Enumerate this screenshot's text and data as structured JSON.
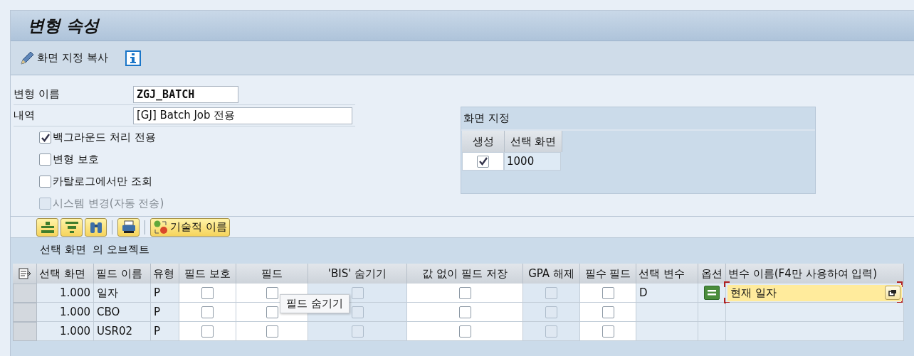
{
  "title": "변형 속성",
  "toolbar": [
    {
      "kind": "pencil",
      "label": "화면 지정 복사"
    },
    {
      "kind": "info"
    }
  ],
  "form": {
    "name_label": "변형 이름",
    "name_value": "ZGJ_BATCH",
    "desc_label": "내역",
    "desc_value": "[GJ] Batch Job 전용",
    "options": [
      {
        "label": "백그라운드 처리 전용",
        "checked": true,
        "disabled": false
      },
      {
        "label": "변형 보호",
        "checked": false,
        "disabled": false
      },
      {
        "label": "카탈로그에서만 조회",
        "checked": false,
        "disabled": false
      },
      {
        "label": "시스템 변경(자동 전송)",
        "checked": false,
        "disabled": true
      }
    ]
  },
  "screen_assignment": {
    "title": "화면 지정",
    "columns": [
      "생성",
      "선택 화면"
    ],
    "rows": [
      {
        "created": true,
        "screen": "1000"
      }
    ]
  },
  "grid_toolbar": [
    {
      "kind": "align-top"
    },
    {
      "kind": "align-center"
    },
    {
      "kind": "binoculars"
    },
    {
      "kind": "separator"
    },
    {
      "kind": "print"
    },
    {
      "kind": "separator"
    },
    {
      "kind": "tech-names",
      "label": "기술적 이름"
    }
  ],
  "objects": {
    "title": "선택 화면  의 오브젝트",
    "columns": [
      {
        "label": "선택 화면",
        "kind": "number"
      },
      {
        "label": "필드 이름",
        "kind": "text"
      },
      {
        "label": "유형",
        "kind": "text"
      },
      {
        "label": "필드 보호",
        "kind": "check"
      },
      {
        "label": "필드",
        "kind": "check"
      },
      {
        "label": "'BIS' 숨기기",
        "kind": "check-disabled"
      },
      {
        "label": "값 없이 필드 저장",
        "kind": "check"
      },
      {
        "label": "GPA 해제",
        "kind": "check-disabled"
      },
      {
        "label": "필수 필드",
        "kind": "check"
      },
      {
        "label": "선택 변수",
        "kind": "text"
      },
      {
        "label": "옵션",
        "kind": "option"
      },
      {
        "label": "변수 이름(F4만 사용하여 입력)",
        "kind": "lookup"
      }
    ],
    "rows": [
      {
        "selected": false,
        "cells": [
          "1.000",
          "일자",
          "P",
          false,
          false,
          false,
          false,
          false,
          false,
          "D",
          true,
          {
            "value": "현재 일자",
            "focused": true
          }
        ]
      },
      {
        "selected": false,
        "cells": [
          "1.000",
          "CBO",
          "P",
          false,
          false,
          false,
          false,
          false,
          false,
          "",
          false,
          null
        ]
      },
      {
        "selected": false,
        "cells": [
          "1.000",
          "USR02",
          "P",
          false,
          false,
          false,
          false,
          false,
          false,
          "",
          false,
          null
        ]
      }
    ]
  },
  "tooltip": "필드 숨기기"
}
